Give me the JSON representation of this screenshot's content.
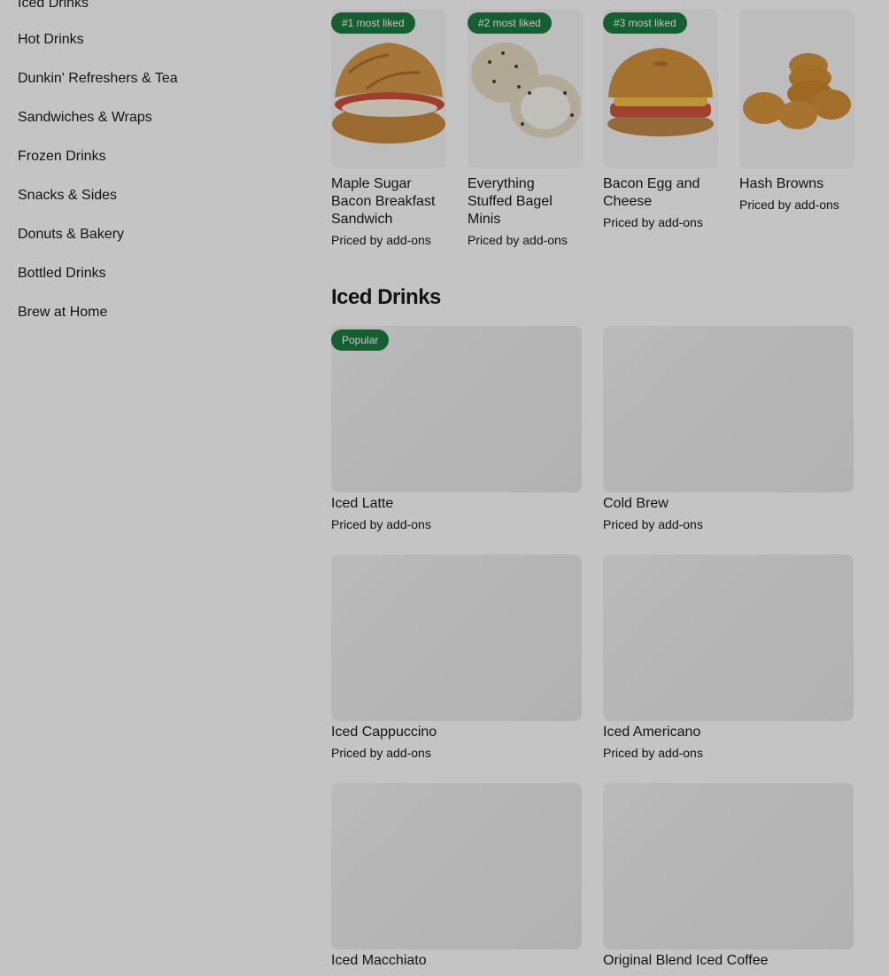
{
  "sidebar": {
    "items": [
      {
        "label": "Iced Drinks"
      },
      {
        "label": "Hot Drinks"
      },
      {
        "label": "Dunkin' Refreshers & Tea"
      },
      {
        "label": "Sandwiches & Wraps"
      },
      {
        "label": "Frozen Drinks"
      },
      {
        "label": "Snacks & Sides"
      },
      {
        "label": "Donuts & Bakery"
      },
      {
        "label": "Bottled Drinks"
      },
      {
        "label": "Brew at Home"
      }
    ]
  },
  "most_liked": {
    "items": [
      {
        "badge": "#1 most liked",
        "name": "Maple Sugar Bacon Breakfast Sandwich",
        "price": "Priced by add-ons"
      },
      {
        "badge": "#2 most liked",
        "name": "Everything Stuffed Bagel Minis",
        "price": "Priced by add-ons"
      },
      {
        "badge": "#3 most liked",
        "name": "Bacon Egg and Cheese",
        "price": "Priced by add-ons"
      },
      {
        "badge": "",
        "name": "Hash Browns",
        "price": "Priced by add-ons"
      }
    ]
  },
  "iced_drinks": {
    "title": "Iced Drinks",
    "items": [
      {
        "badge": "Popular",
        "name": "Iced Latte",
        "price": "Priced by add-ons"
      },
      {
        "badge": "",
        "name": "Cold Brew",
        "price": "Priced by add-ons"
      },
      {
        "badge": "",
        "name": "Iced Cappuccino",
        "price": "Priced by add-ons"
      },
      {
        "badge": "",
        "name": "Iced Americano",
        "price": "Priced by add-ons"
      },
      {
        "badge": "",
        "name": "Iced Macchiato",
        "price": ""
      },
      {
        "badge": "",
        "name": "Original Blend Iced Coffee",
        "price": ""
      }
    ]
  },
  "colors": {
    "badge": "#1c7c3f",
    "text": "#191919",
    "overlay": "rgba(0,0,0,0.23)"
  }
}
